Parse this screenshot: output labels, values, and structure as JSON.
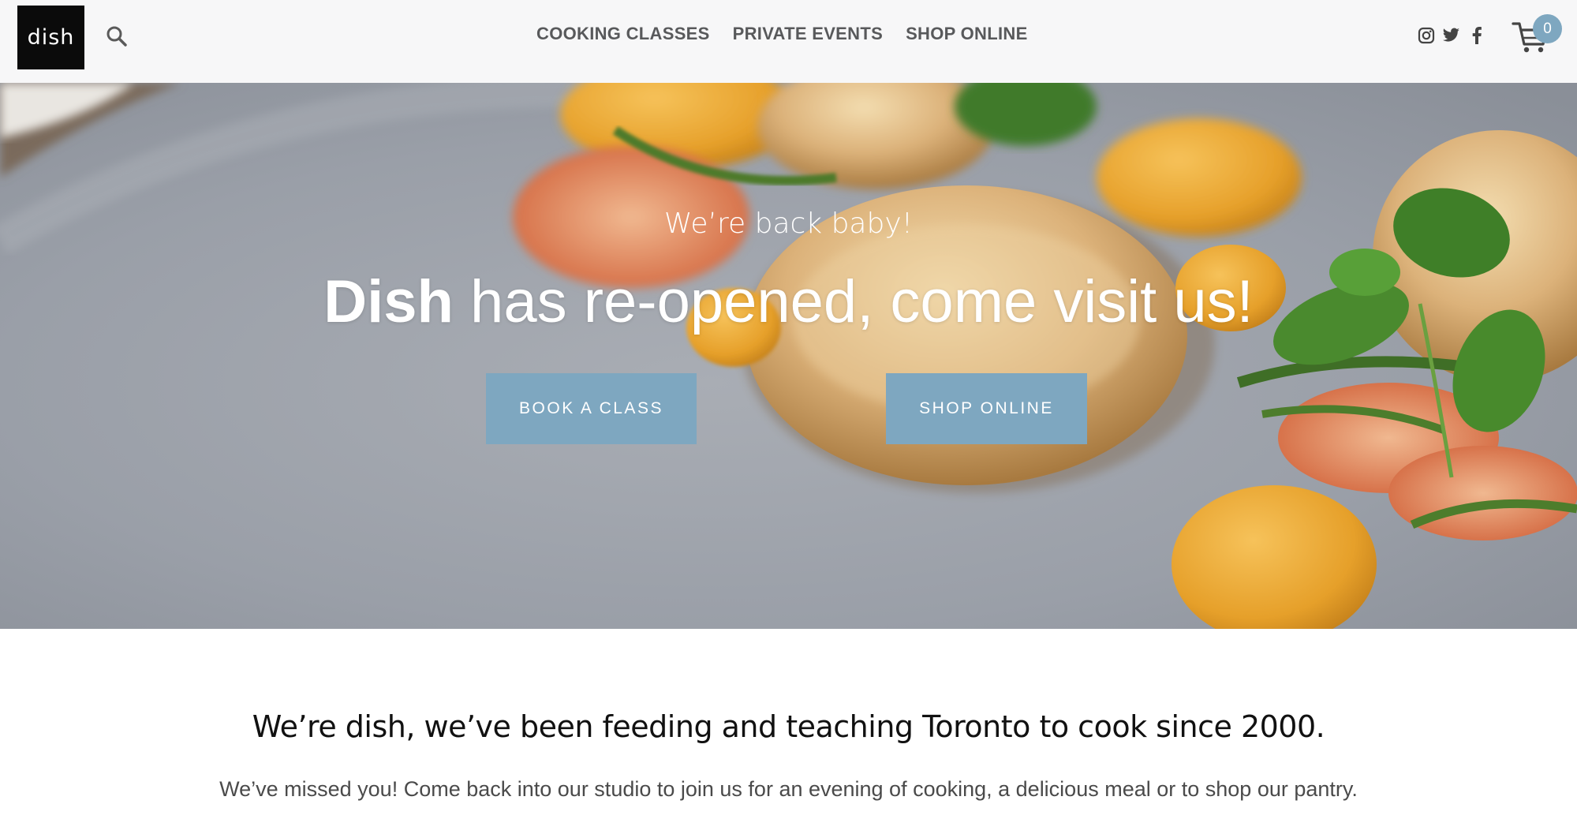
{
  "header": {
    "logo_text": "dish",
    "nav": [
      {
        "label": "COOKING CLASSES"
      },
      {
        "label": "PRIVATE EVENTS"
      },
      {
        "label": "SHOP ONLINE"
      }
    ],
    "social_icons": [
      "instagram-icon",
      "twitter-icon",
      "facebook-icon"
    ],
    "cart_count": "0"
  },
  "hero": {
    "kicker": "We’re back baby!",
    "headline_bold": "Dish",
    "headline_rest": " has re-opened, come visit us!",
    "buttons": [
      {
        "label": "BOOK A CLASS"
      },
      {
        "label": "SHOP ONLINE"
      }
    ]
  },
  "intro": {
    "title": "We’re dish, we’ve been feeding and teaching Toronto to cook since 2000.",
    "text": "We’ve missed you! Come back into our studio to join us for an evening of cooking, a delicious meal or to shop our pantry."
  },
  "colors": {
    "accent": "#7ea7c0",
    "header_bg": "#f7f7f8",
    "logo_bg": "#0b0b0b",
    "nav_text": "#58595b"
  }
}
